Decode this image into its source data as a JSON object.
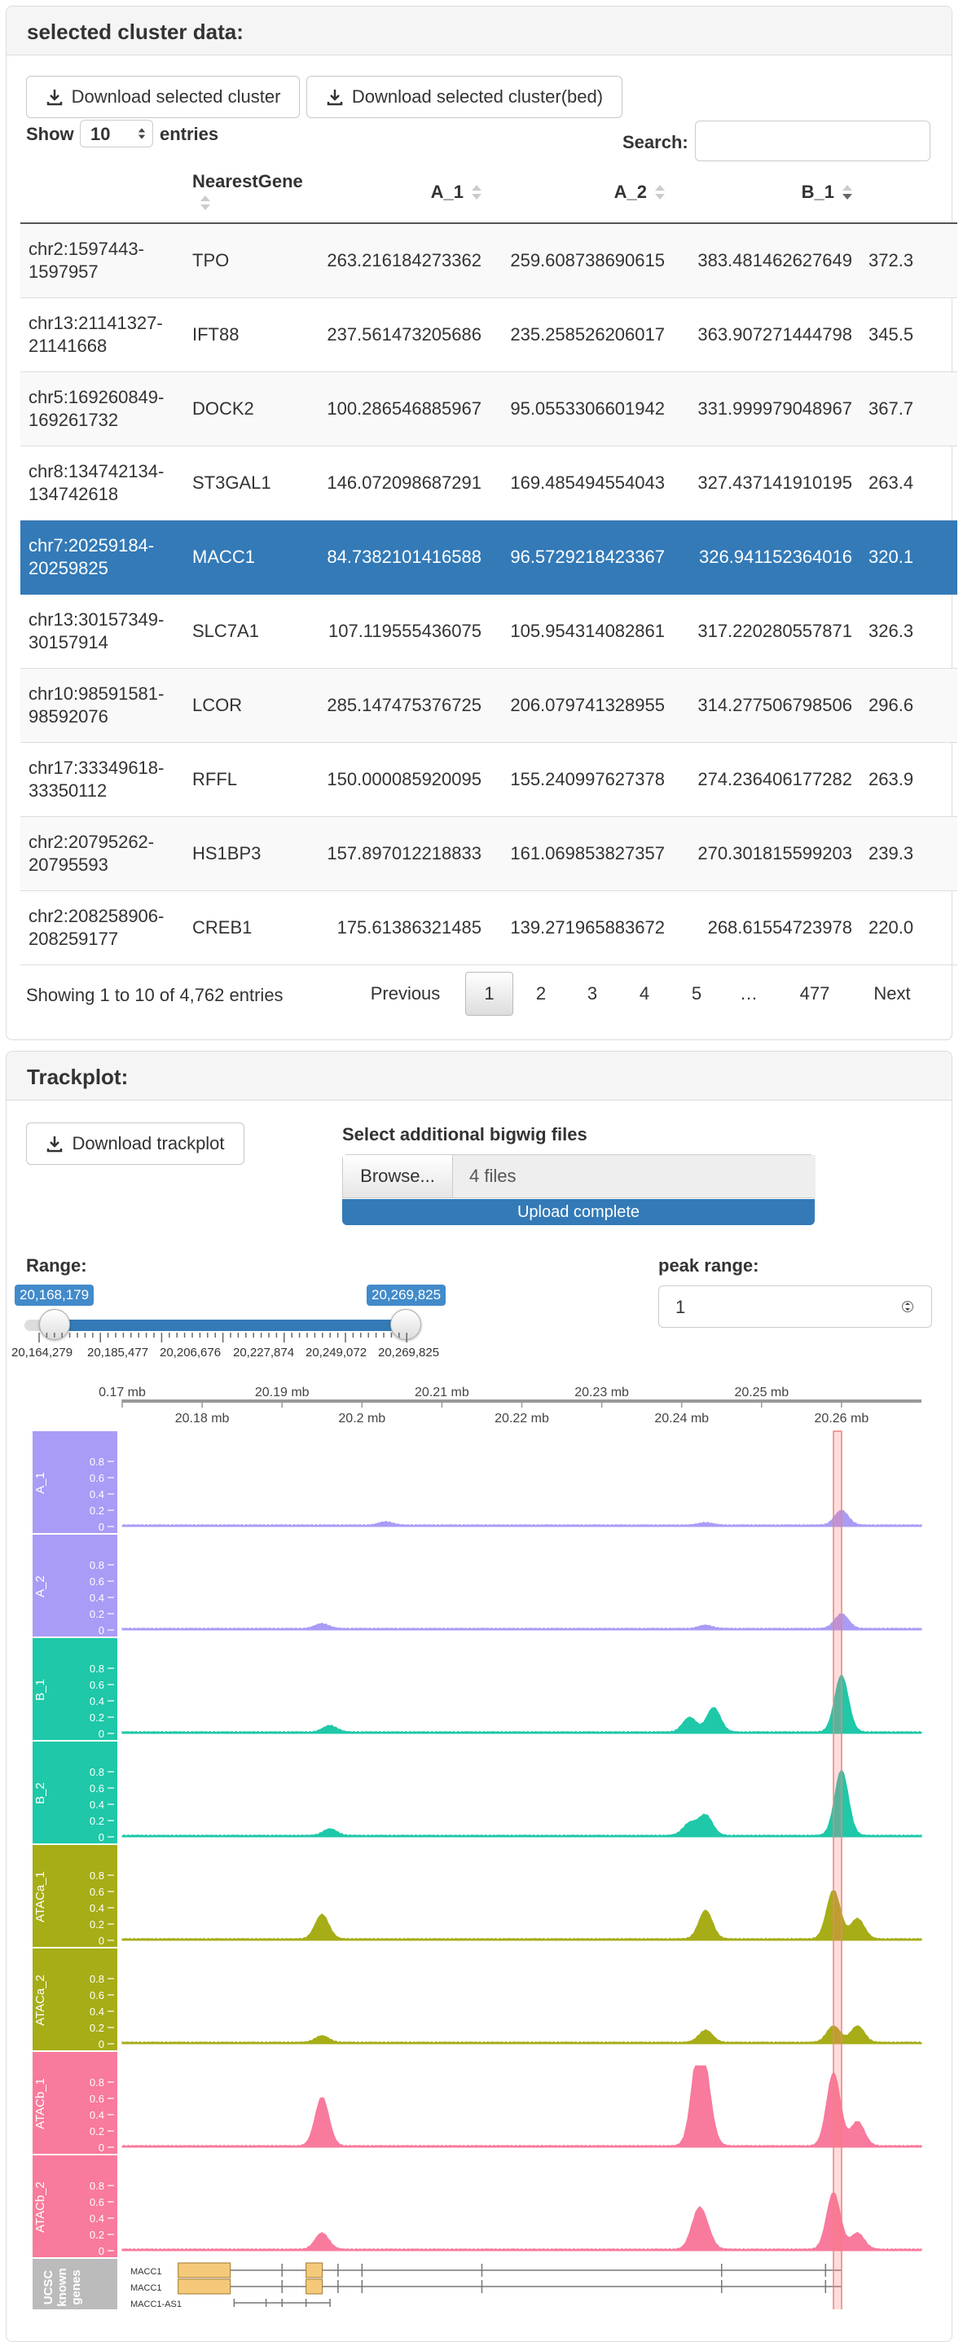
{
  "cluster_panel": {
    "title": "selected cluster data:",
    "download_btn": "Download selected cluster",
    "download_bed_btn": "Download selected cluster(bed)",
    "show_label": "Show",
    "entries_value": "10",
    "entries_label": "entries",
    "search_label": "Search:",
    "columns": [
      "",
      "NearestGene",
      "A_1",
      "A_2",
      "B_1",
      ""
    ],
    "rows": [
      {
        "region": [
          "chr2:1597443-",
          "1597957"
        ],
        "gene": "TPO",
        "a1": "263.216184273362",
        "a2": "259.608738690615",
        "b1": "383.481462627649",
        "extra": "372.3"
      },
      {
        "region": [
          "chr13:21141327-",
          "21141668"
        ],
        "gene": "IFT88",
        "a1": "237.561473205686",
        "a2": "235.258526206017",
        "b1": "363.907271444798",
        "extra": "345.5"
      },
      {
        "region": [
          "chr5:169260849-",
          "169261732"
        ],
        "gene": "DOCK2",
        "a1": "100.286546885967",
        "a2": "95.0553306601942",
        "b1": "331.999979048967",
        "extra": "367.7"
      },
      {
        "region": [
          "chr8:134742134-",
          "134742618"
        ],
        "gene": "ST3GAL1",
        "a1": "146.072098687291",
        "a2": "169.485494554043",
        "b1": "327.437141910195",
        "extra": "263.4"
      },
      {
        "region": [
          "chr7:20259184-",
          "20259825"
        ],
        "gene": "MACC1",
        "a1": "84.7382101416588",
        "a2": "96.5729218423367",
        "b1": "326.941152364016",
        "extra": "320.1"
      },
      {
        "region": [
          "chr13:30157349-",
          "30157914"
        ],
        "gene": "SLC7A1",
        "a1": "107.119555436075",
        "a2": "105.954314082861",
        "b1": "317.220280557871",
        "extra": "326.3"
      },
      {
        "region": [
          "chr10:98591581-",
          "98592076"
        ],
        "gene": "LCOR",
        "a1": "285.147475376725",
        "a2": "206.079741328955",
        "b1": "314.277506798506",
        "extra": "296.6"
      },
      {
        "region": [
          "chr17:33349618-",
          "33350112"
        ],
        "gene": "RFFL",
        "a1": "150.000085920095",
        "a2": "155.240997627378",
        "b1": "274.236406177282",
        "extra": "263.9"
      },
      {
        "region": [
          "chr2:20795262-",
          "20795593"
        ],
        "gene": "HS1BP3",
        "a1": "157.897012218833",
        "a2": "161.069853827357",
        "b1": "270.301815599203",
        "extra": "239.3"
      },
      {
        "region": [
          "chr2:208258906-",
          "208259177"
        ],
        "gene": "CREB1",
        "a1": "175.61386321485",
        "a2": "139.271965883672",
        "b1": "268.61554723978",
        "extra": "220.0"
      }
    ],
    "selected_row": 4,
    "showing_text": "Showing 1 to 10 of 4,762 entries",
    "pagination": {
      "previous": "Previous",
      "pages": [
        "1",
        "2",
        "3",
        "4",
        "5",
        "…",
        "477"
      ],
      "next": "Next",
      "active": "1"
    }
  },
  "trackplot_panel": {
    "title": "Trackplot:",
    "download_btn": "Download trackplot",
    "bigwig_label": "Select additional bigwig files",
    "browse_btn": "Browse...",
    "files_value": "4 files",
    "upload_status": "Upload complete",
    "range_label": "Range:",
    "range_from": "20,168,179",
    "range_to": "20,269,825",
    "range_ticks": [
      "20,164,279",
      "20,185,477",
      "20,206,676",
      "20,227,874",
      "20,249,072",
      "20,269,825"
    ],
    "peak_range_label": "peak range:",
    "peak_range_value": "1"
  },
  "chart_data": {
    "type": "area",
    "x_range": [
      20.17,
      20.27
    ],
    "x_unit": "mb",
    "top_axis_ticks": [
      "0.17 mb",
      "20.19 mb",
      "20.21 mb",
      "20.23 mb",
      "20.25 mb"
    ],
    "bottom_axis_ticks": [
      "20.18 mb",
      "20.2 mb",
      "20.22 mb",
      "20.24 mb",
      "20.26 mb"
    ],
    "ylim": [
      0,
      1
    ],
    "y_ticks": [
      "0",
      "0.2",
      "0.4",
      "0.6",
      "0.8"
    ],
    "highlight_mb": 20.2595,
    "series": [
      {
        "name": "A_1",
        "color": "#a99cf6",
        "peaks": [
          [
            20.203,
            0.04
          ],
          [
            20.243,
            0.03
          ],
          [
            20.26,
            0.18
          ]
        ]
      },
      {
        "name": "A_2",
        "color": "#a99cf6",
        "peaks": [
          [
            20.195,
            0.06
          ],
          [
            20.243,
            0.04
          ],
          [
            20.26,
            0.18
          ]
        ]
      },
      {
        "name": "B_1",
        "color": "#1ec8a8",
        "peaks": [
          [
            20.196,
            0.08
          ],
          [
            20.241,
            0.18
          ],
          [
            20.244,
            0.3
          ],
          [
            20.26,
            0.7
          ]
        ]
      },
      {
        "name": "B_2",
        "color": "#1ec8a8",
        "peaks": [
          [
            20.196,
            0.08
          ],
          [
            20.241,
            0.15
          ],
          [
            20.243,
            0.25
          ],
          [
            20.26,
            0.8
          ]
        ]
      },
      {
        "name": "ATACa_1",
        "color": "#a6ad16",
        "peaks": [
          [
            20.195,
            0.3
          ],
          [
            20.243,
            0.35
          ],
          [
            20.259,
            0.6
          ],
          [
            20.262,
            0.25
          ]
        ]
      },
      {
        "name": "ATACa_2",
        "color": "#a6ad16",
        "peaks": [
          [
            20.195,
            0.08
          ],
          [
            20.243,
            0.15
          ],
          [
            20.259,
            0.2
          ],
          [
            20.262,
            0.2
          ]
        ]
      },
      {
        "name": "ATACb_1",
        "color": "#f87a9c",
        "peaks": [
          [
            20.195,
            0.6
          ],
          [
            20.242,
            0.95
          ],
          [
            20.243,
            0.6
          ],
          [
            20.259,
            0.9
          ],
          [
            20.262,
            0.3
          ]
        ]
      },
      {
        "name": "ATACb_2",
        "color": "#f87a9c",
        "peaks": [
          [
            20.195,
            0.2
          ],
          [
            20.242,
            0.4
          ],
          [
            20.243,
            0.2
          ],
          [
            20.259,
            0.7
          ],
          [
            20.262,
            0.2
          ]
        ]
      }
    ],
    "gene_track": {
      "label": "UCSC known genes",
      "color": "#bbb",
      "genes": [
        "MACC1",
        "MACC1",
        "MACC1-AS1"
      ]
    }
  }
}
